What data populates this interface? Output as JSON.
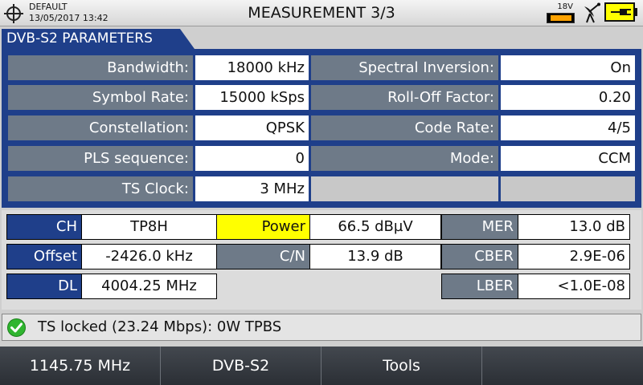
{
  "header": {
    "profile": "DEFAULT",
    "datetime": "13/05/2017 13:42",
    "title": "MEASUREMENT 3/3",
    "voltage": "18V",
    "icons": [
      "crosshair-icon",
      "battery-icon",
      "satellite-dish-icon",
      "power-plug-icon"
    ]
  },
  "params": {
    "tab": "DVB-S2 PARAMETERS",
    "rows": [
      {
        "label_left": "Bandwidth:",
        "value_left": "18000 kHz",
        "label_right": "Spectral Inversion:",
        "value_right": "On"
      },
      {
        "label_left": "Symbol Rate:",
        "value_left": "15000 kSps",
        "label_right": "Roll-Off Factor:",
        "value_right": "0.20"
      },
      {
        "label_left": "Constellation:",
        "value_left": "QPSK",
        "label_right": "Code Rate:",
        "value_right": "4/5"
      },
      {
        "label_left": "PLS sequence:",
        "value_left": "0",
        "label_right": "Mode:",
        "value_right": "CCM"
      },
      {
        "label_left": "TS Clock:",
        "value_left": "3 MHz"
      }
    ]
  },
  "measure": {
    "ch_label": "CH",
    "ch_value": "TP8H",
    "power_label": "Power",
    "power_value": "66.5  dBµV",
    "mer_label": "MER",
    "mer_value": "13.0  dB",
    "offset_label": "Offset",
    "offset_value": "-2426.0  kHz",
    "cn_label": "C/N",
    "cn_value": "13.9  dB",
    "cber_label": "CBER",
    "cber_value": "2.9E-06",
    "dl_label": "DL",
    "dl_value": "4004.25  MHz",
    "lber_label": "LBER",
    "lber_value": "<1.0E-08"
  },
  "status": {
    "text": "TS locked (23.24 Mbps): 0W TPBS",
    "icon": "check-icon",
    "color": "#2fb52f"
  },
  "softkeys": [
    "1145.75 MHz",
    "DVB-S2",
    "Tools",
    ""
  ],
  "colors": {
    "accent": "#1f3f8a",
    "label": "#6e7a88",
    "highlight": "#ffff00"
  }
}
